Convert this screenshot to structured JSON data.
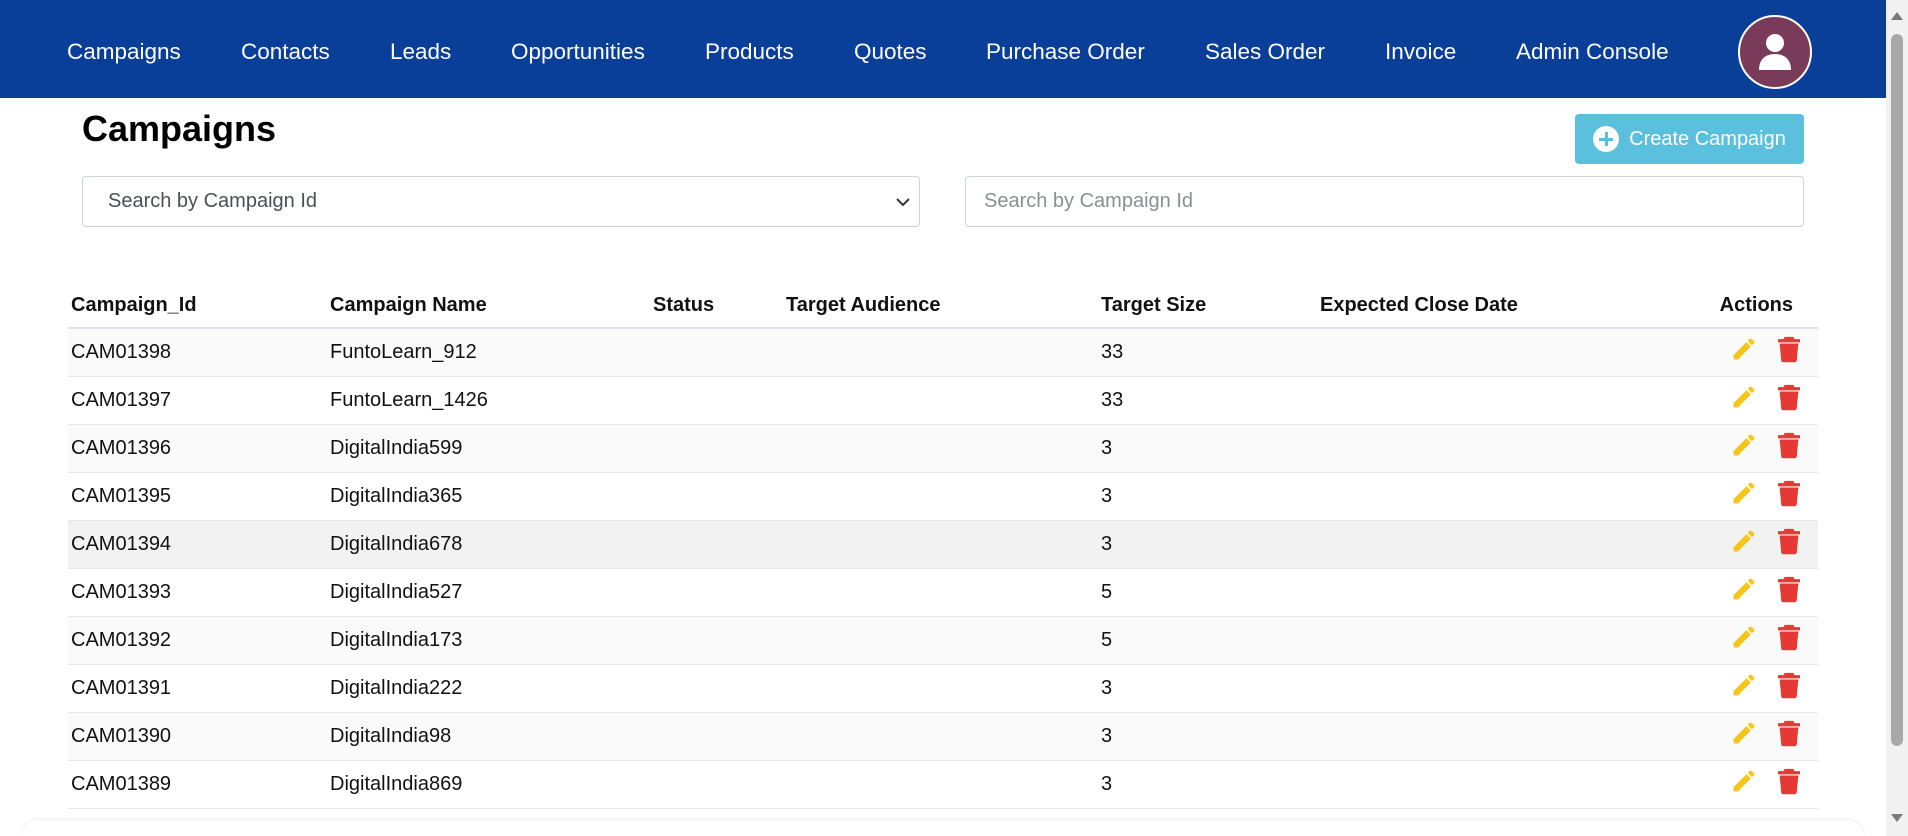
{
  "nav": {
    "items": [
      {
        "label": "Campaigns"
      },
      {
        "label": "Contacts"
      },
      {
        "label": "Leads"
      },
      {
        "label": "Opportunities"
      },
      {
        "label": "Products"
      },
      {
        "label": "Quotes"
      },
      {
        "label": "Purchase Order"
      },
      {
        "label": "Sales Order"
      },
      {
        "label": "Invoice"
      },
      {
        "label": "Admin Console"
      }
    ],
    "avatar_icon": "user-icon"
  },
  "page": {
    "title": "Campaigns",
    "create_button": "Create Campaign",
    "create_icon": "plus-circle-icon"
  },
  "filters": {
    "select_value": "Search by Campaign Id",
    "search_placeholder": "Search by Campaign Id"
  },
  "table": {
    "headers": [
      "Campaign_Id",
      "Campaign Name",
      "Status",
      "Target Audience",
      "Target Size",
      "Expected Close Date",
      "Actions"
    ],
    "rows": [
      {
        "id": "CAM01398",
        "name": "FuntoLearn_912",
        "status": "",
        "audience": "",
        "size": "33",
        "close_date": ""
      },
      {
        "id": "CAM01397",
        "name": "FuntoLearn_1426",
        "status": "",
        "audience": "",
        "size": "33",
        "close_date": ""
      },
      {
        "id": "CAM01396",
        "name": "DigitalIndia599",
        "status": "",
        "audience": "",
        "size": "3",
        "close_date": ""
      },
      {
        "id": "CAM01395",
        "name": "DigitalIndia365",
        "status": "",
        "audience": "",
        "size": "3",
        "close_date": ""
      },
      {
        "id": "CAM01394",
        "name": "DigitalIndia678",
        "status": "",
        "audience": "",
        "size": "3",
        "close_date": ""
      },
      {
        "id": "CAM01393",
        "name": "DigitalIndia527",
        "status": "",
        "audience": "",
        "size": "5",
        "close_date": ""
      },
      {
        "id": "CAM01392",
        "name": "DigitalIndia173",
        "status": "",
        "audience": "",
        "size": "5",
        "close_date": ""
      },
      {
        "id": "CAM01391",
        "name": "DigitalIndia222",
        "status": "",
        "audience": "",
        "size": "3",
        "close_date": ""
      },
      {
        "id": "CAM01390",
        "name": "DigitalIndia98",
        "status": "",
        "audience": "",
        "size": "3",
        "close_date": ""
      },
      {
        "id": "CAM01389",
        "name": "DigitalIndia869",
        "status": "",
        "audience": "",
        "size": "3",
        "close_date": ""
      }
    ],
    "edit_icon": "pencil-icon",
    "delete_icon": "trash-icon"
  },
  "colors": {
    "navbar": "#0a3f99",
    "create_button": "#5bc0de",
    "edit_icon": "#f5c518",
    "delete_icon": "#e53935",
    "avatar": "#7a3a5a"
  }
}
